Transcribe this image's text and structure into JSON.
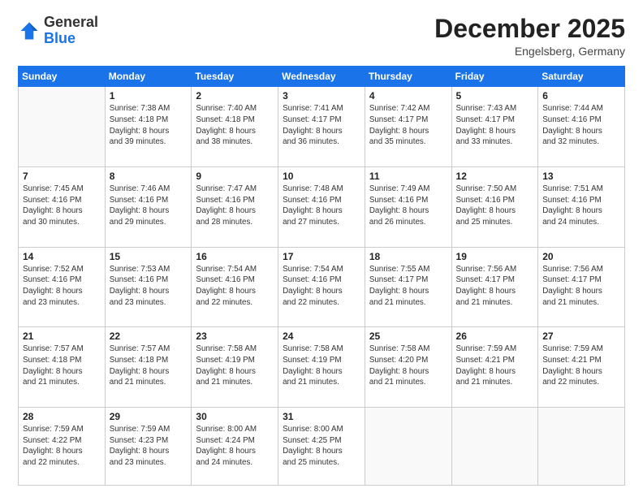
{
  "logo": {
    "general": "General",
    "blue": "Blue"
  },
  "header": {
    "month": "December 2025",
    "location": "Engelsberg, Germany"
  },
  "weekdays": [
    "Sunday",
    "Monday",
    "Tuesday",
    "Wednesday",
    "Thursday",
    "Friday",
    "Saturday"
  ],
  "weeks": [
    [
      {
        "day": "",
        "info": ""
      },
      {
        "day": "1",
        "info": "Sunrise: 7:38 AM\nSunset: 4:18 PM\nDaylight: 8 hours\nand 39 minutes."
      },
      {
        "day": "2",
        "info": "Sunrise: 7:40 AM\nSunset: 4:18 PM\nDaylight: 8 hours\nand 38 minutes."
      },
      {
        "day": "3",
        "info": "Sunrise: 7:41 AM\nSunset: 4:17 PM\nDaylight: 8 hours\nand 36 minutes."
      },
      {
        "day": "4",
        "info": "Sunrise: 7:42 AM\nSunset: 4:17 PM\nDaylight: 8 hours\nand 35 minutes."
      },
      {
        "day": "5",
        "info": "Sunrise: 7:43 AM\nSunset: 4:17 PM\nDaylight: 8 hours\nand 33 minutes."
      },
      {
        "day": "6",
        "info": "Sunrise: 7:44 AM\nSunset: 4:16 PM\nDaylight: 8 hours\nand 32 minutes."
      }
    ],
    [
      {
        "day": "7",
        "info": "Sunrise: 7:45 AM\nSunset: 4:16 PM\nDaylight: 8 hours\nand 30 minutes."
      },
      {
        "day": "8",
        "info": "Sunrise: 7:46 AM\nSunset: 4:16 PM\nDaylight: 8 hours\nand 29 minutes."
      },
      {
        "day": "9",
        "info": "Sunrise: 7:47 AM\nSunset: 4:16 PM\nDaylight: 8 hours\nand 28 minutes."
      },
      {
        "day": "10",
        "info": "Sunrise: 7:48 AM\nSunset: 4:16 PM\nDaylight: 8 hours\nand 27 minutes."
      },
      {
        "day": "11",
        "info": "Sunrise: 7:49 AM\nSunset: 4:16 PM\nDaylight: 8 hours\nand 26 minutes."
      },
      {
        "day": "12",
        "info": "Sunrise: 7:50 AM\nSunset: 4:16 PM\nDaylight: 8 hours\nand 25 minutes."
      },
      {
        "day": "13",
        "info": "Sunrise: 7:51 AM\nSunset: 4:16 PM\nDaylight: 8 hours\nand 24 minutes."
      }
    ],
    [
      {
        "day": "14",
        "info": "Sunrise: 7:52 AM\nSunset: 4:16 PM\nDaylight: 8 hours\nand 23 minutes."
      },
      {
        "day": "15",
        "info": "Sunrise: 7:53 AM\nSunset: 4:16 PM\nDaylight: 8 hours\nand 23 minutes."
      },
      {
        "day": "16",
        "info": "Sunrise: 7:54 AM\nSunset: 4:16 PM\nDaylight: 8 hours\nand 22 minutes."
      },
      {
        "day": "17",
        "info": "Sunrise: 7:54 AM\nSunset: 4:16 PM\nDaylight: 8 hours\nand 22 minutes."
      },
      {
        "day": "18",
        "info": "Sunrise: 7:55 AM\nSunset: 4:17 PM\nDaylight: 8 hours\nand 21 minutes."
      },
      {
        "day": "19",
        "info": "Sunrise: 7:56 AM\nSunset: 4:17 PM\nDaylight: 8 hours\nand 21 minutes."
      },
      {
        "day": "20",
        "info": "Sunrise: 7:56 AM\nSunset: 4:17 PM\nDaylight: 8 hours\nand 21 minutes."
      }
    ],
    [
      {
        "day": "21",
        "info": "Sunrise: 7:57 AM\nSunset: 4:18 PM\nDaylight: 8 hours\nand 21 minutes."
      },
      {
        "day": "22",
        "info": "Sunrise: 7:57 AM\nSunset: 4:18 PM\nDaylight: 8 hours\nand 21 minutes."
      },
      {
        "day": "23",
        "info": "Sunrise: 7:58 AM\nSunset: 4:19 PM\nDaylight: 8 hours\nand 21 minutes."
      },
      {
        "day": "24",
        "info": "Sunrise: 7:58 AM\nSunset: 4:19 PM\nDaylight: 8 hours\nand 21 minutes."
      },
      {
        "day": "25",
        "info": "Sunrise: 7:58 AM\nSunset: 4:20 PM\nDaylight: 8 hours\nand 21 minutes."
      },
      {
        "day": "26",
        "info": "Sunrise: 7:59 AM\nSunset: 4:21 PM\nDaylight: 8 hours\nand 21 minutes."
      },
      {
        "day": "27",
        "info": "Sunrise: 7:59 AM\nSunset: 4:21 PM\nDaylight: 8 hours\nand 22 minutes."
      }
    ],
    [
      {
        "day": "28",
        "info": "Sunrise: 7:59 AM\nSunset: 4:22 PM\nDaylight: 8 hours\nand 22 minutes."
      },
      {
        "day": "29",
        "info": "Sunrise: 7:59 AM\nSunset: 4:23 PM\nDaylight: 8 hours\nand 23 minutes."
      },
      {
        "day": "30",
        "info": "Sunrise: 8:00 AM\nSunset: 4:24 PM\nDaylight: 8 hours\nand 24 minutes."
      },
      {
        "day": "31",
        "info": "Sunrise: 8:00 AM\nSunset: 4:25 PM\nDaylight: 8 hours\nand 25 minutes."
      },
      {
        "day": "",
        "info": ""
      },
      {
        "day": "",
        "info": ""
      },
      {
        "day": "",
        "info": ""
      }
    ]
  ]
}
